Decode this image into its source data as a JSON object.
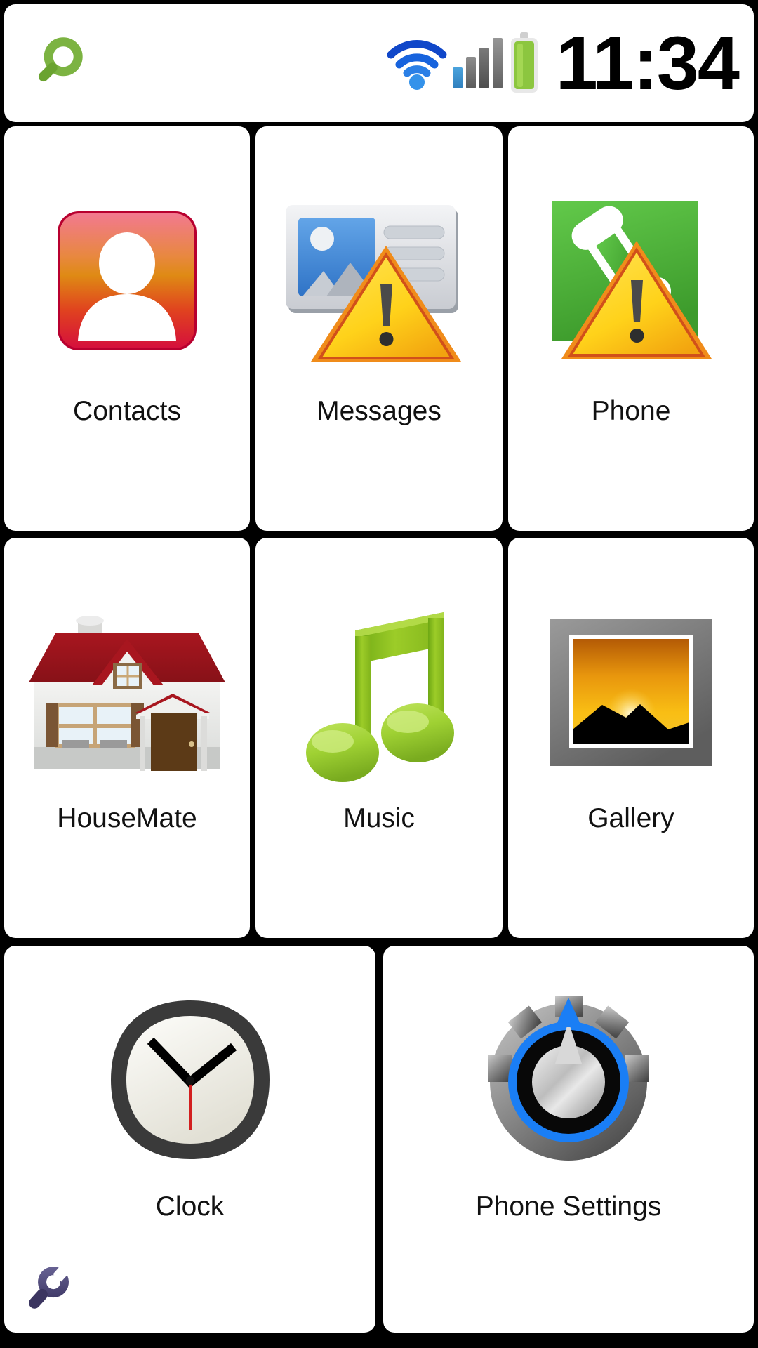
{
  "statusbar": {
    "search_icon": "search-icon",
    "wifi_icon": "wifi-icon",
    "signal_icon": "cellular-signal-icon",
    "battery_icon": "battery-full-icon",
    "time": "11:34",
    "signal_bars_total": 4,
    "signal_bars_active": 1,
    "battery_level_percent": 100
  },
  "grid": {
    "rows": [
      {
        "tiles": [
          {
            "label": "Contacts",
            "icon": "contacts-icon",
            "badge": null
          },
          {
            "label": "Messages",
            "icon": "messages-icon",
            "badge": "warning-triangle-icon"
          },
          {
            "label": "Phone",
            "icon": "phone-icon",
            "badge": "warning-triangle-icon"
          }
        ]
      },
      {
        "tiles": [
          {
            "label": "HouseMate",
            "icon": "house-icon",
            "badge": null
          },
          {
            "label": "Music",
            "icon": "music-note-icon",
            "badge": null
          },
          {
            "label": "Gallery",
            "icon": "gallery-icon",
            "badge": null
          }
        ]
      },
      {
        "tiles": [
          {
            "label": "Clock",
            "icon": "analog-clock-icon",
            "badge": "wrench-icon"
          },
          {
            "label": "Phone Settings",
            "icon": "settings-gear-icon",
            "badge": null
          }
        ]
      }
    ]
  },
  "colors": {
    "background": "#000000",
    "tile": "#ffffff",
    "label_text": "#111111",
    "search_green": "#7cb342",
    "wifi_blue": "#1565d8",
    "battery_green": "#8cc63f",
    "warning_yellow": "#ffd42a",
    "warning_orange": "#f39c12",
    "phone_green": "#4caf33",
    "roof_red": "#9e1b21",
    "music_green": "#8cc63f",
    "gallery_orange": "#f7a81b",
    "settings_blue": "#1a7ef5",
    "wrench_purple": "#4f4a7d"
  }
}
